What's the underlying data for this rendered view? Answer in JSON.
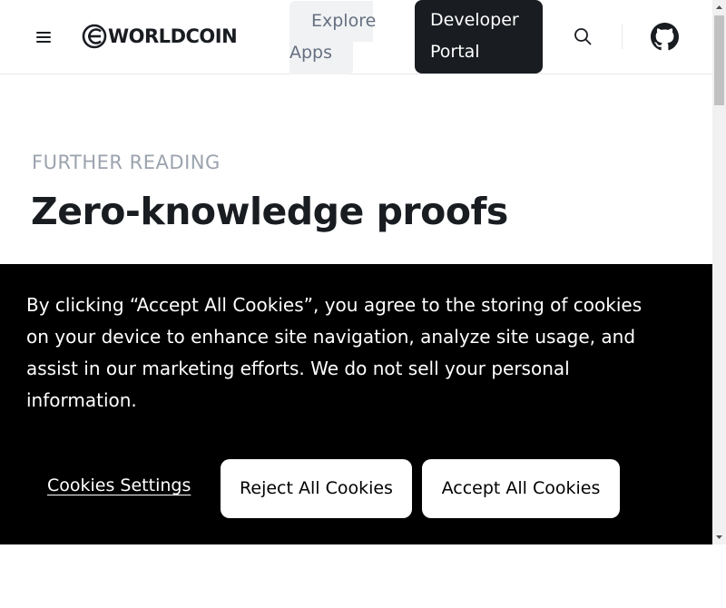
{
  "header": {
    "logo_text": "WORLDCOIN",
    "explore_label": "Explore Apps",
    "developer_label": "Developer Portal",
    "icons": [
      "menu-icon",
      "worldcoin-logo-icon",
      "search-icon",
      "github-icon"
    ]
  },
  "main": {
    "eyebrow": "FURTHER READING",
    "title": "Zero-knowledge proofs"
  },
  "cookie_banner": {
    "text": "By clicking “Accept All Cookies”, you agree to the storing of cookies on your device to enhance site navigation, analyze site usage, and assist in our marketing efforts. We do not sell your personal information.",
    "settings_label": "Cookies Settings",
    "reject_label": "Reject All Cookies",
    "accept_label": "Accept All Cookies"
  },
  "colors": {
    "ink": "#191c20",
    "muted": "#9ba3ae",
    "banner_bg": "#000000",
    "button_bg": "#ffffff"
  }
}
